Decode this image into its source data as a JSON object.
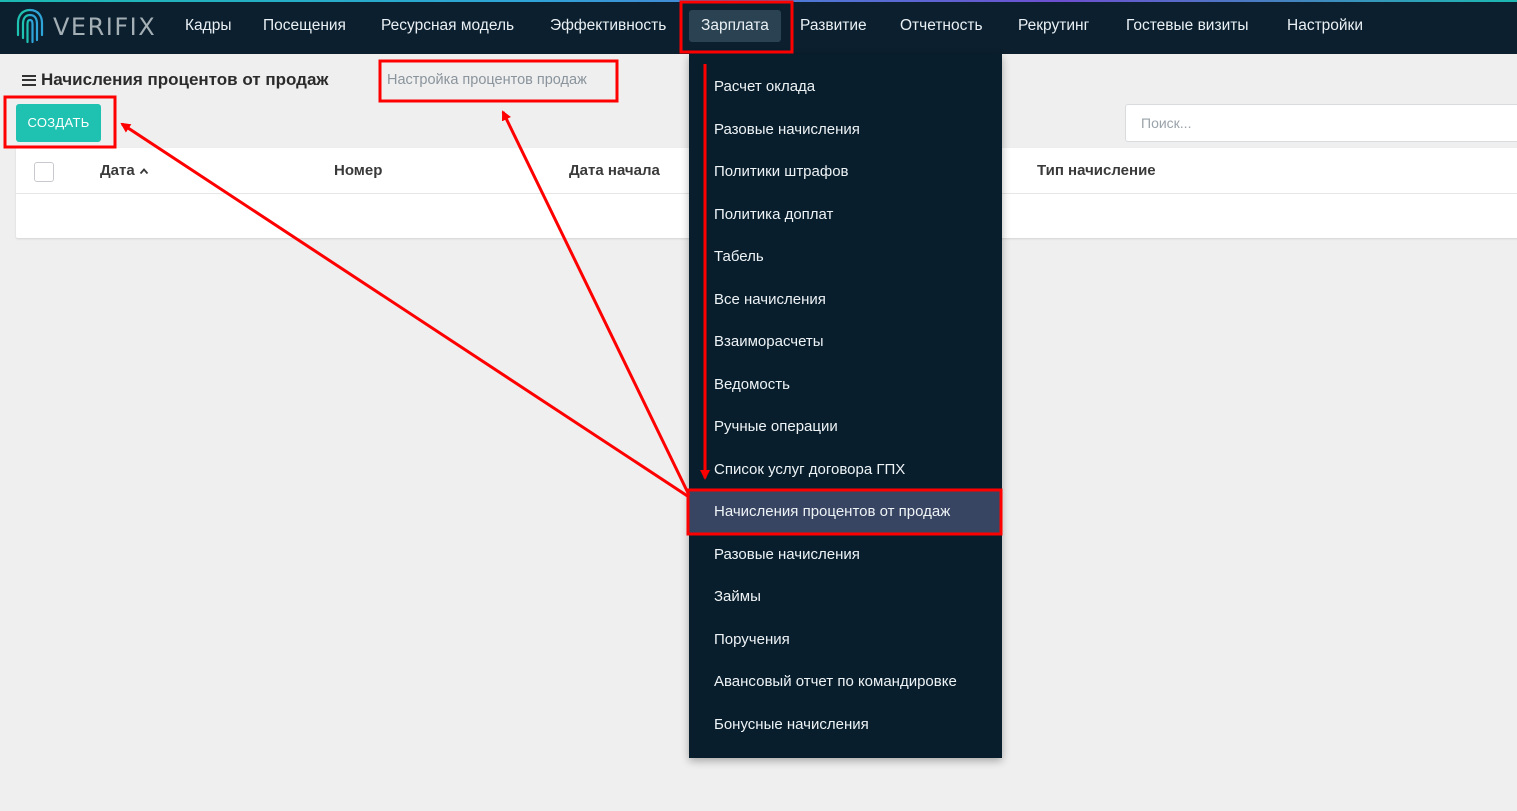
{
  "app": {
    "logo_text": "VERIFIX"
  },
  "nav": [
    {
      "label": "Кадры"
    },
    {
      "label": "Посещения"
    },
    {
      "label": "Ресурсная модель"
    },
    {
      "label": "Эффективность"
    },
    {
      "label": "Зарплата",
      "active": true
    },
    {
      "label": "Развитие"
    },
    {
      "label": "Отчетность"
    },
    {
      "label": "Рекрутинг"
    },
    {
      "label": "Гостевые визиты"
    },
    {
      "label": "Настройки"
    }
  ],
  "page": {
    "title": "Начисления процентов от продаж",
    "settings_link": "Настройка процентов продаж",
    "create_label": "СОЗДАТЬ",
    "search_placeholder": "Поиск..."
  },
  "table": {
    "columns": [
      "Дата",
      "Номер",
      "Дата начала",
      "Тип начисление"
    ],
    "sort_column": "Дата"
  },
  "dropdown": {
    "items": [
      "Расчет оклада",
      "Разовые начисления",
      "Политики штрафов",
      "Политика доплат",
      "Табель",
      "Все начисления",
      "Взаиморасчеты",
      "Ведомость",
      "Ручные операции",
      "Список услуг договора ГПХ",
      "Начисления процентов от продаж",
      "Разовые начисления",
      "Займы",
      "Поручения",
      "Авансовый отчет по командировке",
      "Бонусные начисления"
    ],
    "active_item": "Начисления процентов от продаж"
  },
  "colors": {
    "topbar": "#0b1f2e",
    "dropdown": "#081e2c",
    "dropdown_active": "#374462",
    "accent": "#1fc2b1",
    "annotation": "#ff0000"
  },
  "icons": {
    "logo": "fingerprint-logo-icon",
    "menu": "hamburger-icon",
    "sort": "sort-ascending-icon"
  }
}
